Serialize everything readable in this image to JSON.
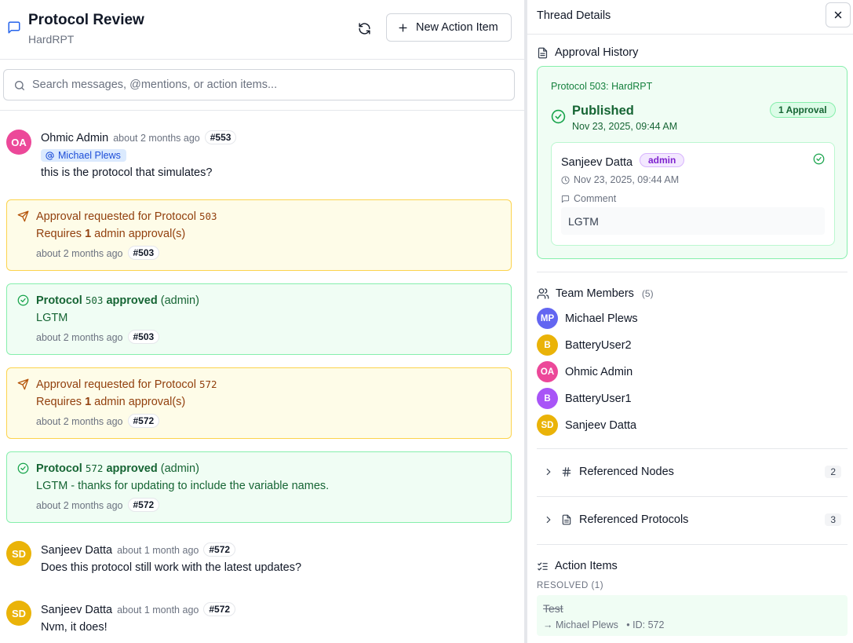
{
  "header": {
    "title": "Protocol Review",
    "subtitle": "HardRPT",
    "new_action_label": "New Action Item"
  },
  "search": {
    "placeholder": "Search messages, @mentions, or action items..."
  },
  "messages": [
    {
      "initials": "OA",
      "author": "Ohmic Admin",
      "time": "about 2 months ago",
      "tag": "#553",
      "mention": "Michael Plews",
      "text": "this is the protocol that simulates?",
      "avatar_color": "#ec4899"
    },
    {
      "initials": "SD",
      "author": "Sanjeev Datta",
      "time": "about 1 month ago",
      "tag": "#572",
      "text": "Does this protocol still work with the latest updates?",
      "avatar_color": "#eab308"
    },
    {
      "initials": "SD",
      "author": "Sanjeev Datta",
      "time": "about 1 month ago",
      "tag": "#572",
      "text": "Nvm, it does!",
      "avatar_color": "#eab308"
    }
  ],
  "events": [
    {
      "kind": "request",
      "prefix": "Approval requested for Protocol",
      "protocol": "503",
      "req_pre": "Requires",
      "req_count": "1",
      "req_post": "admin approval(s)",
      "time": "about 2 months ago",
      "tag": "#503"
    },
    {
      "kind": "approved",
      "prefix": "Protocol",
      "protocol": "503",
      "verb": "approved",
      "role": "(admin)",
      "comment": "LGTM",
      "time": "about 2 months ago",
      "tag": "#503"
    },
    {
      "kind": "request",
      "prefix": "Approval requested for Protocol",
      "protocol": "572",
      "req_pre": "Requires",
      "req_count": "1",
      "req_post": "admin approval(s)",
      "time": "about 2 months ago",
      "tag": "#572"
    },
    {
      "kind": "approved",
      "prefix": "Protocol",
      "protocol": "572",
      "verb": "approved",
      "role": "(admin)",
      "comment": "LGTM - thanks for updating to include the variable names.",
      "time": "about 2 months ago",
      "tag": "#572"
    }
  ],
  "panel": {
    "title": "Thread Details",
    "approval": {
      "heading": "Approval History",
      "protocol": "Protocol 503: HardRPT",
      "status": "Published",
      "date": "Nov 23, 2025, 09:44 AM",
      "badge": "1 Approval",
      "approver": "Sanjeev Datta",
      "role": "admin",
      "approver_date": "Nov 23, 2025, 09:44 AM",
      "comment_label": "Comment",
      "comment": "LGTM"
    },
    "team": {
      "heading": "Team Members",
      "count": "(5)",
      "members": [
        {
          "initials": "MP",
          "name": "Michael Plews",
          "color": "#6366f1"
        },
        {
          "initials": "B",
          "name": "BatteryUser2",
          "color": "#eab308"
        },
        {
          "initials": "OA",
          "name": "Ohmic Admin",
          "color": "#ec4899"
        },
        {
          "initials": "B",
          "name": "BatteryUser1",
          "color": "#a855f7"
        },
        {
          "initials": "SD",
          "name": "Sanjeev Datta",
          "color": "#eab308"
        }
      ]
    },
    "ref_nodes": {
      "label": "Referenced Nodes",
      "count": "2"
    },
    "ref_protocols": {
      "label": "Referenced Protocols",
      "count": "3"
    },
    "actions": {
      "heading": "Action Items",
      "resolved_label": "RESOLVED (1)",
      "item_title": "Test",
      "assignee": "→ Michael Plews",
      "id": "• ID: 572"
    }
  },
  "colors": {
    "request_bg": "#fefce8",
    "approved_bg": "#f0fdf4",
    "accent": "#2563eb"
  }
}
